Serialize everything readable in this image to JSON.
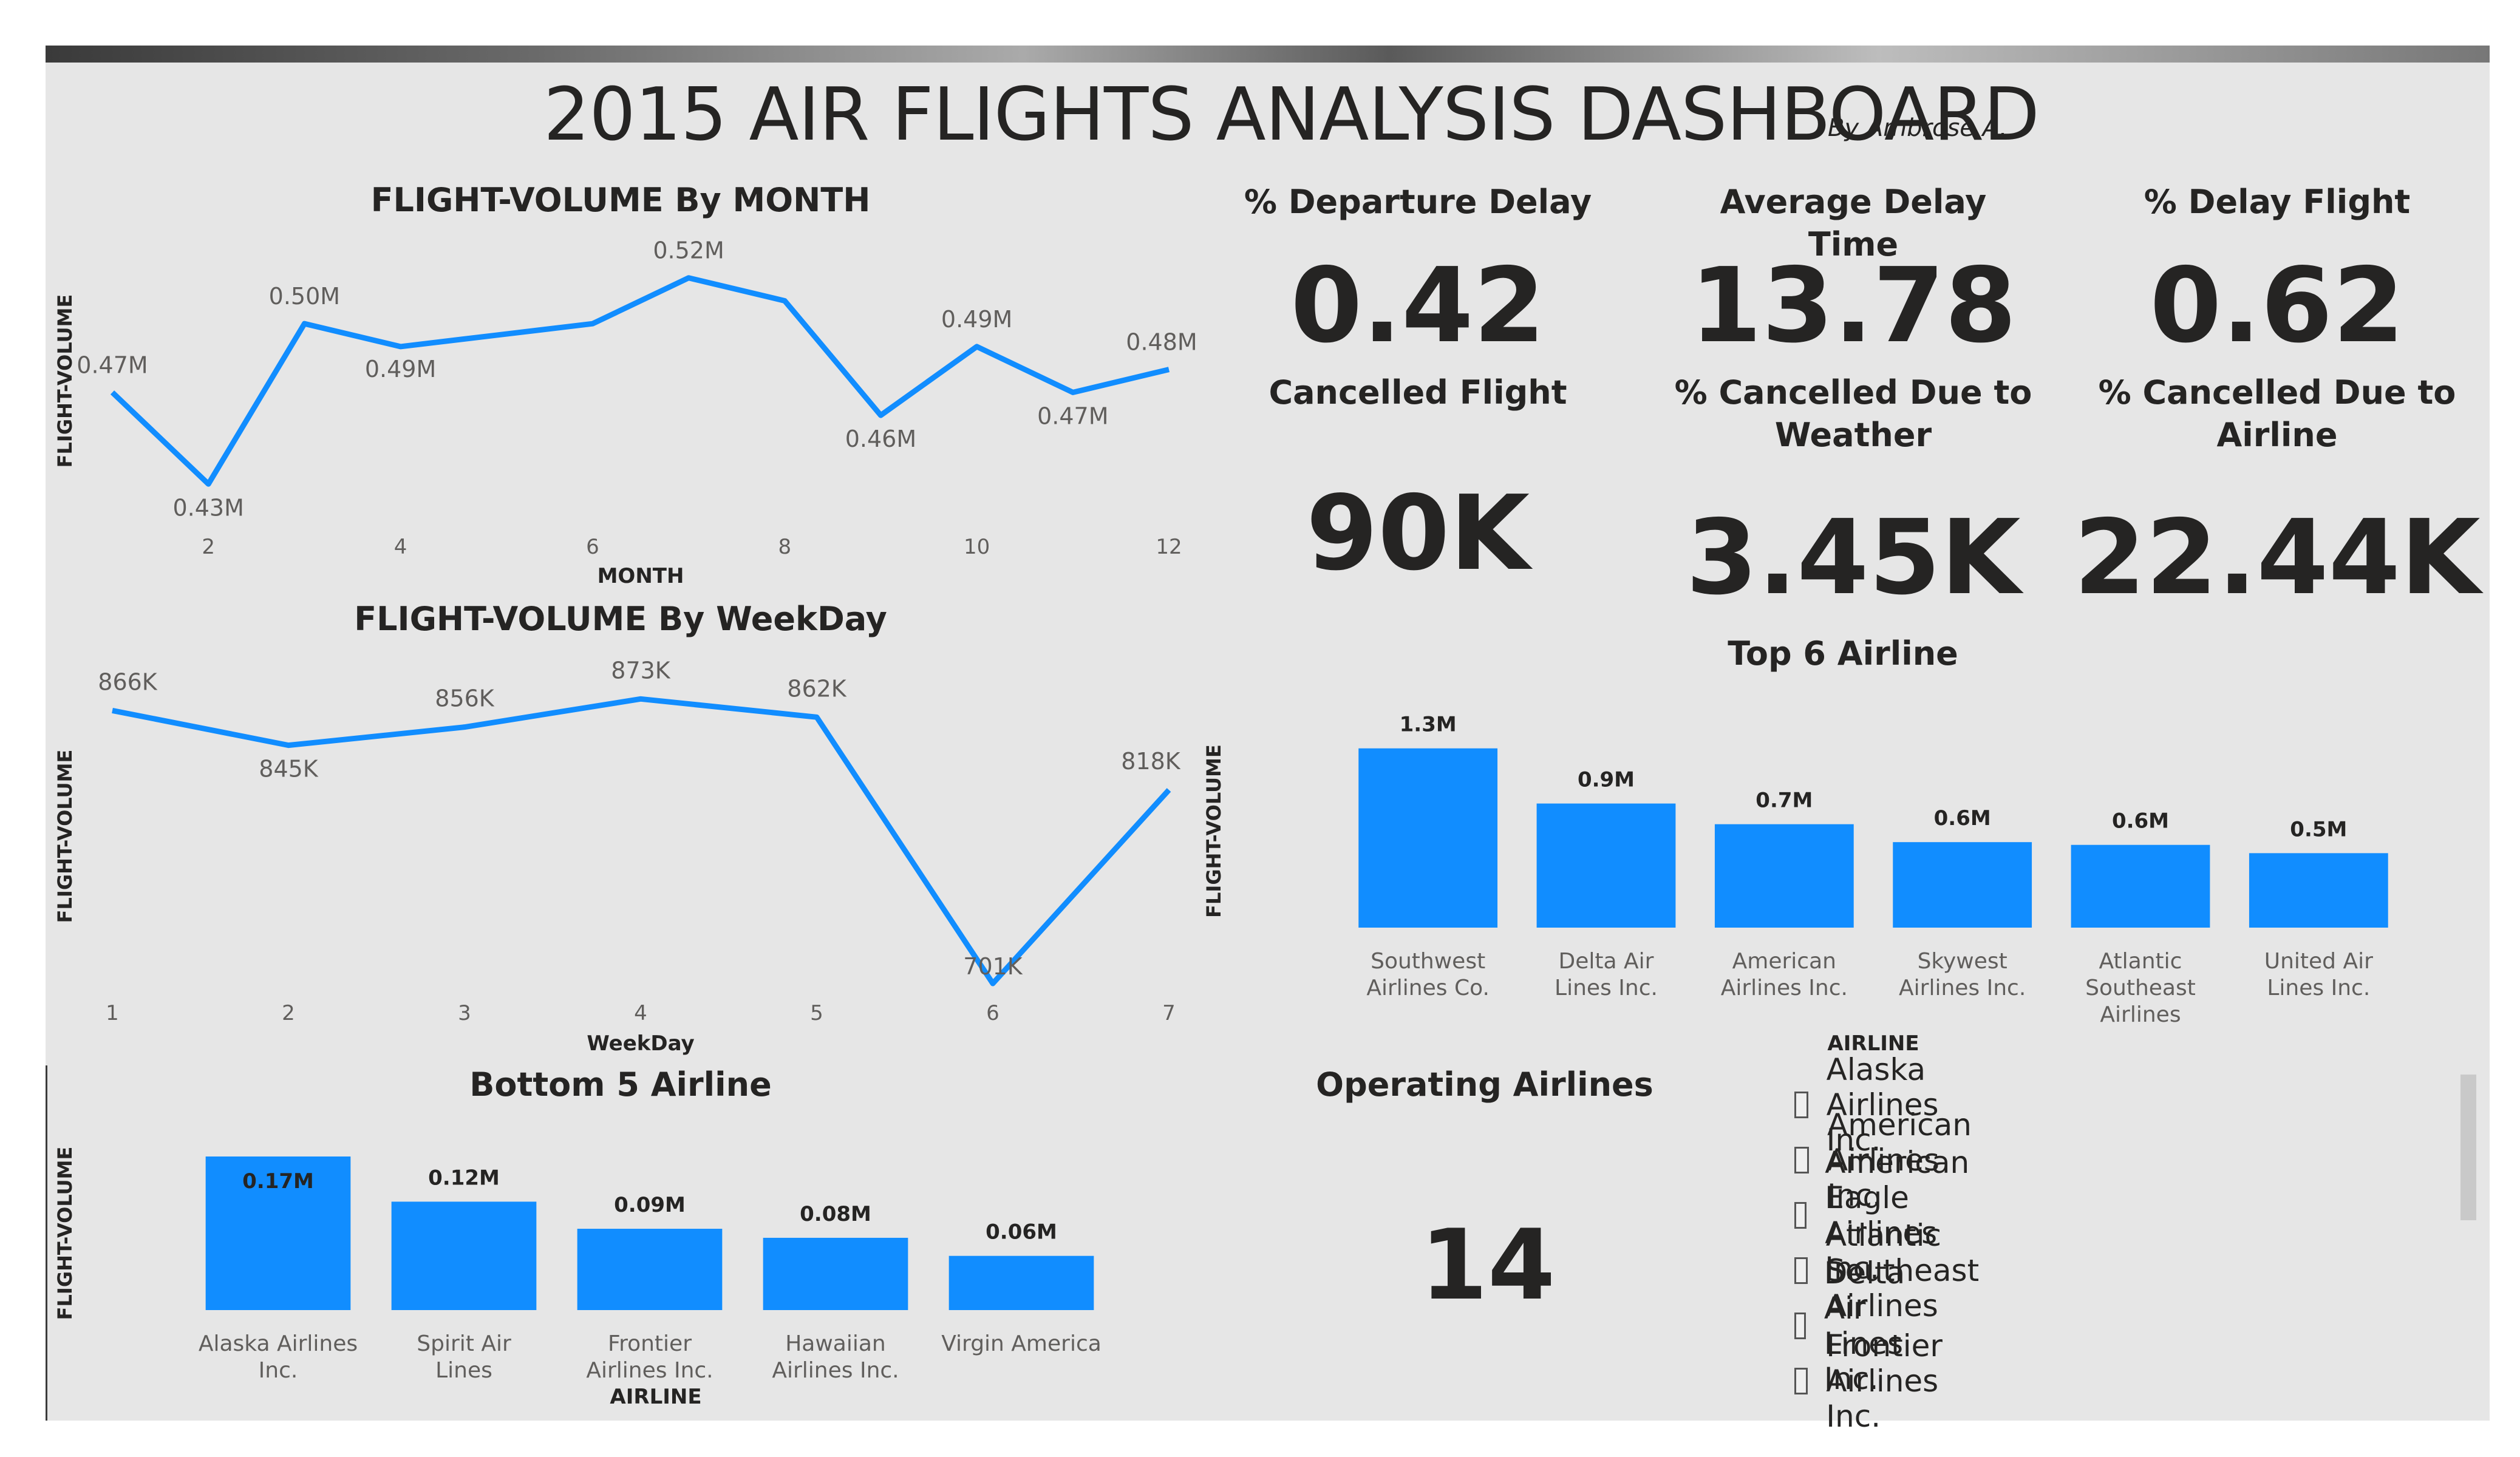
{
  "header": {
    "title": "2015 AIR FLIGHTS ANALYSIS DASHBOARD",
    "author": "By Ambrose A."
  },
  "kpis": [
    {
      "label": "% Departure Delay",
      "value": "0.42"
    },
    {
      "label": "Average Delay Time",
      "value": "13.78"
    },
    {
      "label": "% Delay Flight",
      "value": "0.62"
    },
    {
      "label": "Cancelled Flight",
      "value": "90K"
    },
    {
      "label": "% Cancelled Due to Weather",
      "value": "3.45K"
    },
    {
      "label": "% Cancelled Due to Airline",
      "value": "22.44K"
    }
  ],
  "operating": {
    "label": "Operating Airlines",
    "value": "14"
  },
  "slicer": {
    "items": [
      "Alaska Airlines Inc.",
      "American Airlines Inc.",
      "American Eagle Airlines Inc.",
      "Atlantic Southeast Airlines",
      "Delta Air Lines Inc.",
      "Frontier Airlines Inc."
    ]
  },
  "colors": {
    "accent": "#118dff",
    "background": "#e6e6e6",
    "text": "#252423"
  },
  "chart_data": [
    {
      "id": "month",
      "type": "line",
      "title": "FLIGHT-VOLUME By MONTH",
      "xlabel": "MONTH",
      "ylabel": "FLIGHT-VOLUME",
      "x": [
        1,
        2,
        3,
        4,
        5,
        6,
        7,
        8,
        9,
        10,
        11,
        12
      ],
      "values": [
        0.47,
        0.43,
        0.5,
        0.49,
        0.495,
        0.5,
        0.52,
        0.51,
        0.46,
        0.49,
        0.47,
        0.48
      ],
      "data_labels": [
        "0.47M",
        "0.43M",
        "0.50M",
        "0.49M",
        "",
        "",
        "0.52M",
        "",
        "0.46M",
        "0.49M",
        "0.47M",
        "0.48M"
      ],
      "x_ticks": [
        "2",
        "4",
        "6",
        "8",
        "10",
        "12"
      ],
      "ylim": [
        0.42,
        0.53
      ],
      "grid": false
    },
    {
      "id": "weekday",
      "type": "line",
      "title": "FLIGHT-VOLUME By WeekDay",
      "xlabel": "WeekDay",
      "ylabel": "FLIGHT-VOLUME",
      "x": [
        1,
        2,
        3,
        4,
        5,
        6,
        7
      ],
      "values": [
        866,
        845,
        856,
        873,
        862,
        701,
        818
      ],
      "data_labels": [
        "866K",
        "845K",
        "856K",
        "873K",
        "862K",
        "701K",
        "818K"
      ],
      "x_ticks": [
        "1",
        "2",
        "3",
        "4",
        "5",
        "6",
        "7"
      ],
      "ylim": [
        690,
        890
      ],
      "grid": false
    },
    {
      "id": "top6",
      "type": "bar",
      "title": "Top 6 Airline",
      "xlabel": "AIRLINE",
      "ylabel": "FLIGHT-VOLUME",
      "categories": [
        "Southwest Airlines Co.",
        "Delta Air Lines Inc.",
        "American Airlines Inc.",
        "Skywest Airlines Inc.",
        "Atlantic Southeast Airlines",
        "United Air Lines Inc."
      ],
      "values": [
        1.3,
        0.9,
        0.75,
        0.62,
        0.6,
        0.54
      ],
      "data_labels": [
        "1.3M",
        "0.9M",
        "0.7M",
        "0.6M",
        "0.6M",
        "0.5M"
      ],
      "ylim": [
        0,
        1.4
      ]
    },
    {
      "id": "bottom5",
      "type": "bar",
      "title": "Bottom 5 Airline",
      "xlabel": "AIRLINE",
      "ylabel": "FLIGHT-VOLUME",
      "categories": [
        "Alaska Airlines Inc.",
        "Spirit Air Lines",
        "Frontier Airlines Inc.",
        "Hawaiian Airlines Inc.",
        "Virgin America"
      ],
      "values": [
        0.17,
        0.12,
        0.09,
        0.08,
        0.06
      ],
      "data_labels": [
        "0.17M",
        "0.12M",
        "0.09M",
        "0.08M",
        "0.06M"
      ],
      "ylim": [
        0,
        0.17
      ]
    }
  ]
}
